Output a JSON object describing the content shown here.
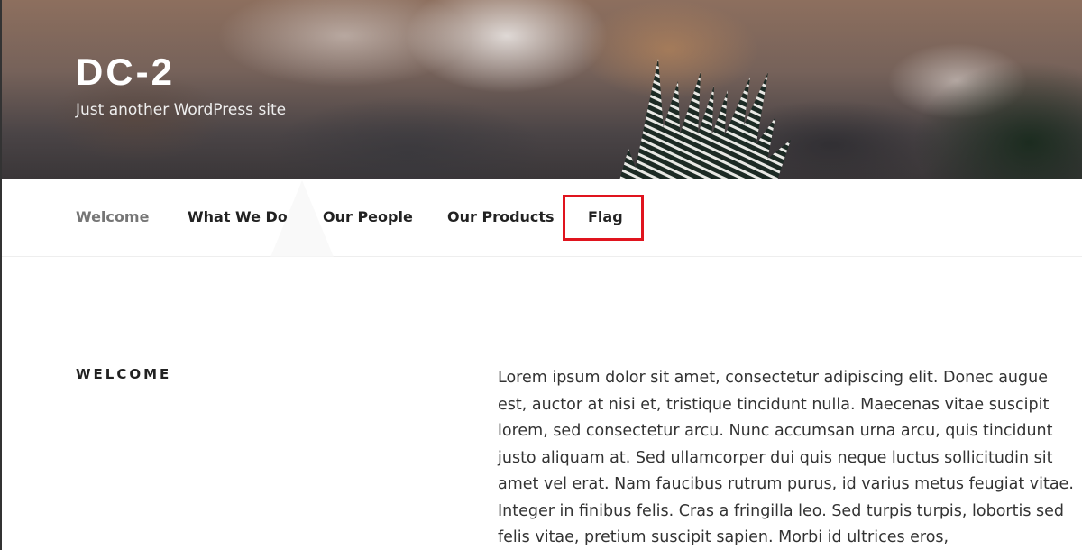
{
  "site": {
    "title": "DC-2",
    "tagline": "Just another WordPress site"
  },
  "nav": {
    "items": [
      {
        "label": "Welcome",
        "current": true
      },
      {
        "label": "What We Do",
        "current": false
      },
      {
        "label": "Our People",
        "current": false
      },
      {
        "label": "Our Products",
        "current": false
      },
      {
        "label": "Flag",
        "current": false,
        "highlighted": true
      }
    ],
    "highlight_color": "#e0141e"
  },
  "content": {
    "heading": "WELCOME",
    "body": "Lorem ipsum dolor sit amet, consectetur adipiscing elit. Donec augue est, auctor at nisi et, tristique tincidunt nulla. Maecenas vitae suscipit lorem, sed consectetur arcu. Nunc accumsan urna arcu, quis tincidunt justo aliquam at. Sed ullamcorper dui quis neque luctus sollicitudin sit amet vel erat. Nam faucibus rutrum purus, id varius metus feugiat vitae. Integer in finibus felis. Cras a fringilla leo. Sed turpis turpis, lobortis sed felis vitae, pretium suscipit sapien. Morbi id ultrices eros,"
  },
  "colors": {
    "nav_current": "#767676",
    "nav_text": "#222222",
    "body_text": "#333333"
  }
}
